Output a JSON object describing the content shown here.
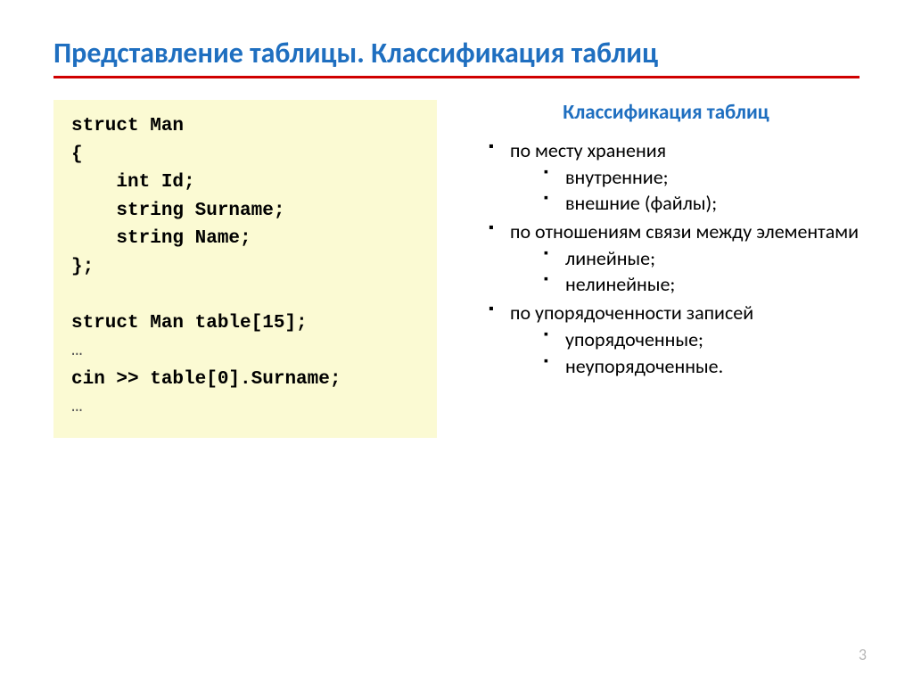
{
  "title": "Представление таблицы. Классификация таблиц",
  "code": {
    "l1": "struct Man",
    "l2": "{",
    "l3": "    int Id;",
    "l4": "    string Surname;",
    "l5": "    string Name;",
    "l6": "};",
    "l7": "",
    "l8": "struct Man table[15];",
    "l9": "…",
    "l10": "cin >> table[0].Surname;",
    "l11": "…"
  },
  "subheading": "Классификация таблиц",
  "list": {
    "i1": "по месту хранения",
    "i1a": "внутренние;",
    "i1b": "внешние (файлы);",
    "i2": "по отношениям связи между элементами",
    "i2a": "линейные;",
    "i2b": "нелинейные;",
    "i3": "по упорядоченности записей",
    "i3a": "упорядоченные;",
    "i3b": "неупорядоченные."
  },
  "page": "3"
}
